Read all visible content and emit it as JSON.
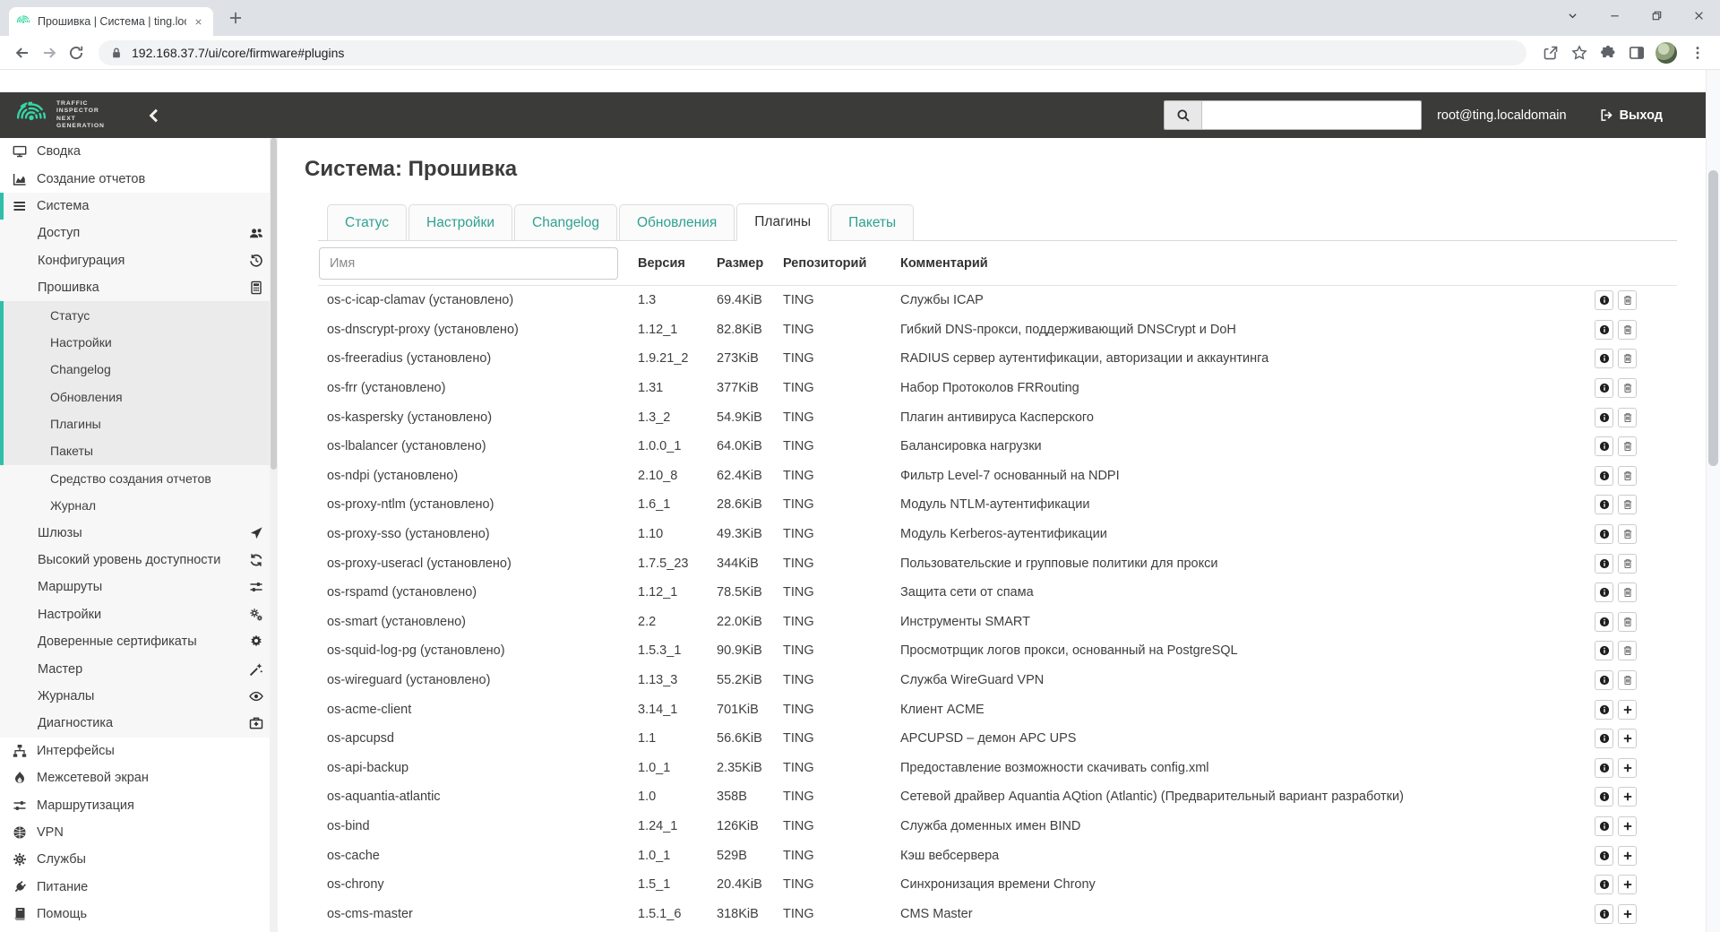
{
  "colors": {
    "accent_teal": "#2fbfa7",
    "link_teal": "#2fa190",
    "header_bg": "#3b3b3a",
    "logo_green": "#35d6a4"
  },
  "browser": {
    "tab_title": "Прошивка | Система | ting.localdomain",
    "url": "192.168.37.7/ui/core/firmware#plugins"
  },
  "header": {
    "logo_lines": [
      "TRAFFIC",
      "INSPECTOR",
      "NEXT",
      "GENERATION"
    ],
    "user": "root@ting.localdomain",
    "logout_label": "Выход"
  },
  "sidebar": {
    "items": [
      {
        "id": "svodka",
        "label": "Сводка",
        "level": 0,
        "icon": "desktop"
      },
      {
        "id": "sozdanie-otchetov",
        "label": "Создание отчетов",
        "level": 0,
        "icon": "chart-area"
      },
      {
        "id": "sistema",
        "label": "Система",
        "level": 0,
        "icon": "list",
        "accent": true
      },
      {
        "id": "dostup",
        "label": "Доступ",
        "level": 1,
        "icon_right": "users"
      },
      {
        "id": "konfiguratsiya",
        "label": "Конфигурация",
        "level": 1,
        "icon_right": "history"
      },
      {
        "id": "proshivka",
        "label": "Прошивка",
        "level": 1,
        "icon_right": "firmware"
      },
      {
        "id": "status",
        "label": "Статус",
        "level": 2,
        "group": true
      },
      {
        "id": "nastroyki-fw",
        "label": "Настройки",
        "level": 2,
        "group": true
      },
      {
        "id": "changelog",
        "label": "Changelog",
        "level": 2,
        "group": true
      },
      {
        "id": "obnovleniya",
        "label": "Обновления",
        "level": 2,
        "group": true
      },
      {
        "id": "plaginy",
        "label": "Плагины",
        "level": 2,
        "group": true
      },
      {
        "id": "pakety",
        "label": "Пакеты",
        "level": 2,
        "group": true
      },
      {
        "id": "sredstvo-otchetov",
        "label": "Средство создания отчетов",
        "level": 2
      },
      {
        "id": "zhurnal",
        "label": "Журнал",
        "level": 2
      },
      {
        "id": "shlyuzy",
        "label": "Шлюзы",
        "level": 1,
        "icon_right": "location-arrow"
      },
      {
        "id": "vysokiy-uroven",
        "label": "Высокий уровень доступности",
        "level": 1,
        "icon_right": "refresh"
      },
      {
        "id": "marshruty",
        "label": "Маршруты",
        "level": 1,
        "icon_right": "sliders"
      },
      {
        "id": "nastroyki-sys",
        "label": "Настройки",
        "level": 1,
        "icon_right": "gears"
      },
      {
        "id": "sertifikaty",
        "label": "Доверенные сертификаты",
        "level": 1,
        "icon_right": "certificate"
      },
      {
        "id": "master",
        "label": "Мастер",
        "level": 1,
        "icon_right": "magic-wand"
      },
      {
        "id": "zhurnaly",
        "label": "Журналы",
        "level": 1,
        "icon_right": "eye"
      },
      {
        "id": "diagnostika",
        "label": "Диагностика",
        "level": 1,
        "icon_right": "medkit"
      },
      {
        "id": "interfeysy",
        "label": "Интерфейсы",
        "level": 0,
        "icon": "sitemap"
      },
      {
        "id": "mezhsetevoy-ekran",
        "label": "Межсетевой экран",
        "level": 0,
        "icon": "fire"
      },
      {
        "id": "marshrutizatsiya",
        "label": "Маршрутизация",
        "level": 0,
        "icon": "sliders"
      },
      {
        "id": "vpn",
        "label": "VPN",
        "level": 0,
        "icon": "globe"
      },
      {
        "id": "sluzhby",
        "label": "Службы",
        "level": 0,
        "icon": "gear"
      },
      {
        "id": "pitanie",
        "label": "Питание",
        "level": 0,
        "icon": "plug"
      },
      {
        "id": "pomosch",
        "label": "Помощь",
        "level": 0,
        "icon": "book"
      }
    ]
  },
  "main": {
    "title": "Система: Прошивка",
    "tabs": [
      {
        "id": "status",
        "label": "Статус",
        "active": false
      },
      {
        "id": "nastroyki",
        "label": "Настройки",
        "active": false
      },
      {
        "id": "changelog",
        "label": "Changelog",
        "active": false
      },
      {
        "id": "obnovleniya",
        "label": "Обновления",
        "active": false
      },
      {
        "id": "plaginy",
        "label": "Плагины",
        "active": true
      },
      {
        "id": "pakety",
        "label": "Пакеты",
        "active": false
      }
    ],
    "table": {
      "name_filter_placeholder": "Имя",
      "installed_label": "(установлено)",
      "columns": [
        "Версия",
        "Размер",
        "Репозиторий",
        "Комментарий"
      ],
      "rows": [
        {
          "name": "os-c-icap-clamav",
          "installed": true,
          "version": "1.3",
          "size": "69.4KiB",
          "repo": "TING",
          "comment": "Службы ICAP"
        },
        {
          "name": "os-dnscrypt-proxy",
          "installed": true,
          "version": "1.12_1",
          "size": "82.8KiB",
          "repo": "TING",
          "comment": "Гибкий DNS-прокси, поддерживающий DNSCrypt и DoH"
        },
        {
          "name": "os-freeradius",
          "installed": true,
          "version": "1.9.21_2",
          "size": "273KiB",
          "repo": "TING",
          "comment": "RADIUS сервер аутентификации, авторизации и аккаунтинга"
        },
        {
          "name": "os-frr",
          "installed": true,
          "version": "1.31",
          "size": "377KiB",
          "repo": "TING",
          "comment": "Набор Протоколов FRRouting"
        },
        {
          "name": "os-kaspersky",
          "installed": true,
          "version": "1.3_2",
          "size": "54.9KiB",
          "repo": "TING",
          "comment": "Плагин антивируса Касперского"
        },
        {
          "name": "os-lbalancer",
          "installed": true,
          "version": "1.0.0_1",
          "size": "64.0KiB",
          "repo": "TING",
          "comment": "Балансировка нагрузки"
        },
        {
          "name": "os-ndpi",
          "installed": true,
          "version": "2.10_8",
          "size": "62.4KiB",
          "repo": "TING",
          "comment": "Фильтр Level-7 основанный на NDPI"
        },
        {
          "name": "os-proxy-ntlm",
          "installed": true,
          "version": "1.6_1",
          "size": "28.6KiB",
          "repo": "TING",
          "comment": "Модуль NTLM-аутентификации"
        },
        {
          "name": "os-proxy-sso",
          "installed": true,
          "version": "1.10",
          "size": "49.3KiB",
          "repo": "TING",
          "comment": "Модуль Kerberos-аутентификации"
        },
        {
          "name": "os-proxy-useracl",
          "installed": true,
          "version": "1.7.5_23",
          "size": "344KiB",
          "repo": "TING",
          "comment": "Пользовательские и групповые политики для прокси"
        },
        {
          "name": "os-rspamd",
          "installed": true,
          "version": "1.12_1",
          "size": "78.5KiB",
          "repo": "TING",
          "comment": "Защита сети от спама"
        },
        {
          "name": "os-smart",
          "installed": true,
          "version": "2.2",
          "size": "22.0KiB",
          "repo": "TING",
          "comment": "Инструменты SMART"
        },
        {
          "name": "os-squid-log-pg",
          "installed": true,
          "version": "1.5.3_1",
          "size": "90.9KiB",
          "repo": "TING",
          "comment": "Просмотрщик логов прокси, основанный на PostgreSQL"
        },
        {
          "name": "os-wireguard",
          "installed": true,
          "version": "1.13_3",
          "size": "55.2KiB",
          "repo": "TING",
          "comment": "Служба WireGuard VPN"
        },
        {
          "name": "os-acme-client",
          "installed": false,
          "version": "3.14_1",
          "size": "701KiB",
          "repo": "TING",
          "comment": "Клиент ACME"
        },
        {
          "name": "os-apcupsd",
          "installed": false,
          "version": "1.1",
          "size": "56.6KiB",
          "repo": "TING",
          "comment": "APCUPSD – демон APC UPS"
        },
        {
          "name": "os-api-backup",
          "installed": false,
          "version": "1.0_1",
          "size": "2.35KiB",
          "repo": "TING",
          "comment": "Предоставление возможности скачивать config.xml"
        },
        {
          "name": "os-aquantia-atlantic",
          "installed": false,
          "version": "1.0",
          "size": "358B",
          "repo": "TING",
          "comment": "Сетевой драйвер Aquantia AQtion (Atlantic) (Предварительный вариант разработки)"
        },
        {
          "name": "os-bind",
          "installed": false,
          "version": "1.24_1",
          "size": "126KiB",
          "repo": "TING",
          "comment": "Служба доменных имен BIND"
        },
        {
          "name": "os-cache",
          "installed": false,
          "version": "1.0_1",
          "size": "529B",
          "repo": "TING",
          "comment": "Кэш вебсервера"
        },
        {
          "name": "os-chrony",
          "installed": false,
          "version": "1.5_1",
          "size": "20.4KiB",
          "repo": "TING",
          "comment": "Синхронизация времени Chrony"
        },
        {
          "name": "os-cms-master",
          "installed": false,
          "version": "1.5.1_6",
          "size": "318KiB",
          "repo": "TING",
          "comment": "CMS Master"
        }
      ]
    }
  }
}
